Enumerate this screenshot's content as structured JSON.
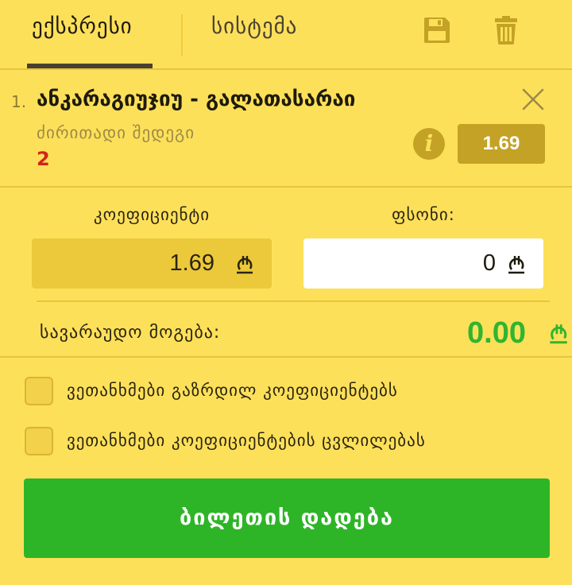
{
  "tabs": [
    {
      "label": "ექსპრესი",
      "active": true
    },
    {
      "label": "სისტემა",
      "active": false
    }
  ],
  "toolbar": {
    "save_icon": "floppy-disk-icon",
    "delete_icon": "trash-icon"
  },
  "bet": {
    "index": "1.",
    "title": "ანკარაგიუჯიუ - გალათასარაი",
    "market": "ძირითადი შედეგი",
    "pick": "2",
    "odds": "1.69"
  },
  "coefficient": {
    "label": "კოეფიციენტი",
    "value": "1.69"
  },
  "stake": {
    "label": "ფსონი:",
    "value": "0"
  },
  "winnings": {
    "label": "სავარაუდო მოგება:",
    "value": "0.00"
  },
  "options": [
    {
      "label": "ვეთანხმები გაზრდილ კოეფიციენტებს",
      "checked": false
    },
    {
      "label": "ვეთანხმები კოეფიციენტების ცვლილებას",
      "checked": false
    }
  ],
  "place_bet_label": "ბილეთის დადება",
  "colors": {
    "background": "#fde05a",
    "accent_green": "#2eb527",
    "odds_badge": "#c4a225",
    "pick_red": "#d4231a"
  }
}
